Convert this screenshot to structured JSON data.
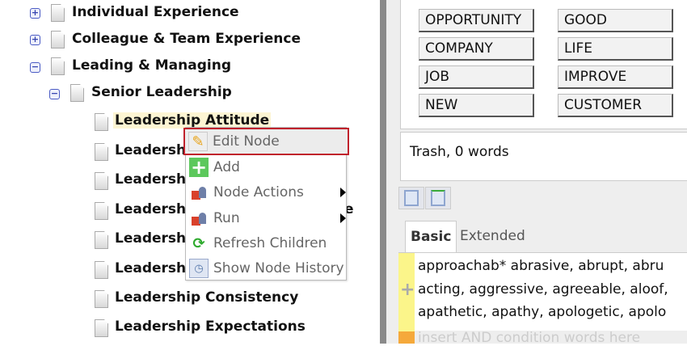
{
  "tree": {
    "items": [
      {
        "label": "Individual Experience",
        "expander": "+"
      },
      {
        "label": "Colleague & Team Experience",
        "expander": "+"
      },
      {
        "label": "Leading & Managing",
        "expander": "−"
      },
      {
        "label": "Senior Leadership",
        "expander": "−"
      },
      {
        "label": "Leadership Attitude"
      },
      {
        "label": "Leadershi"
      },
      {
        "label": "Leadershi"
      },
      {
        "label": "Leadershi",
        "trailing": "e"
      },
      {
        "label": "Leadershi"
      },
      {
        "label": "Leadershi"
      },
      {
        "label": "Leadership Consistency"
      },
      {
        "label": "Leadership Expectations"
      }
    ]
  },
  "context_menu": {
    "items": [
      {
        "label": "Edit Node",
        "icon": "pencil-icon"
      },
      {
        "label": "Add",
        "icon": "plus-icon"
      },
      {
        "label": "Node Actions",
        "icon": "node-actions-icon",
        "submenu": true
      },
      {
        "label": "Run",
        "icon": "run-icon",
        "submenu": true
      },
      {
        "label": "Refresh Children",
        "icon": "refresh-icon"
      },
      {
        "label": "Show Node History",
        "icon": "history-icon"
      }
    ]
  },
  "words": {
    "left": [
      "OPPORTUNITY",
      "COMPANY",
      "JOB",
      "NEW"
    ],
    "right": [
      "GOOD",
      "LIFE",
      "IMPROVE",
      "CUSTOMER"
    ]
  },
  "trash": {
    "label": "Trash, 0 words"
  },
  "tabs": {
    "basic": "Basic",
    "extended": "Extended"
  },
  "editor": {
    "lines": [
      "approachab* abrasive, abrupt, abru",
      "acting, aggressive, agreeable, aloof,",
      "apathetic, apathy, apologetic, apolo"
    ],
    "and_placeholder": "insert AND condition words here"
  },
  "colors": {
    "highlight_border": "#c0222c",
    "condition_yellow": "#fbf58a",
    "condition_orange": "#f5a93b"
  }
}
